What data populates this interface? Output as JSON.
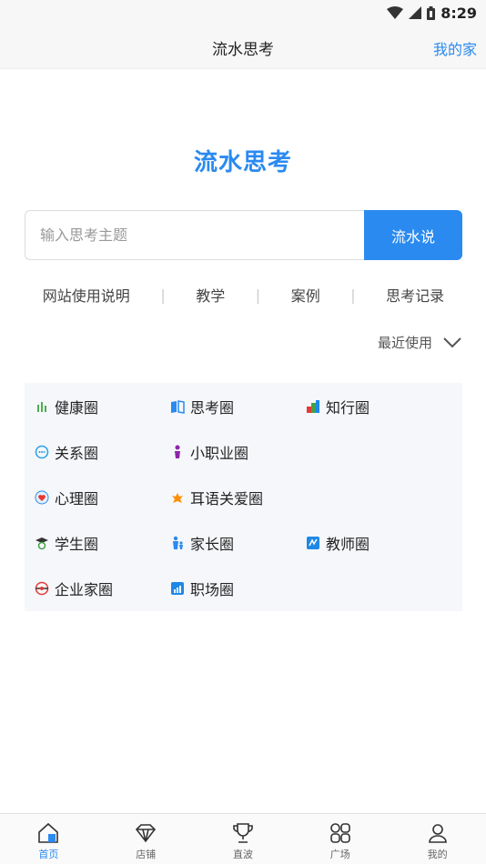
{
  "status": {
    "time": "8:29"
  },
  "header": {
    "title": "流水思考",
    "right_link": "我的家"
  },
  "brand": {
    "title": "流水思考"
  },
  "search": {
    "placeholder": "输入思考主题",
    "value": "",
    "button": "流水说"
  },
  "links": [
    "网站使用说明",
    "教学",
    "案例",
    "思考记录"
  ],
  "recent": {
    "label": "最近使用"
  },
  "circles": [
    {
      "label": "健康圈",
      "icon": "leaf-icon",
      "color": "#4caf50"
    },
    {
      "label": "思考圈",
      "icon": "book-icon",
      "color": "#2a8af0"
    },
    {
      "label": "知行圈",
      "icon": "blocks-icon",
      "color": "#e53935"
    },
    {
      "label": "关系圈",
      "icon": "chat-bubble-icon",
      "color": "#29a0e8"
    },
    {
      "label": "小职业圈",
      "icon": "person-icon",
      "color": "#8e24aa"
    },
    {
      "label": "心理圈",
      "icon": "heart-shield-icon",
      "color": "#e53935"
    },
    {
      "label": "耳语关爱圈",
      "icon": "sparkle-icon",
      "color": "#ff8f00"
    },
    {
      "label": "学生圈",
      "icon": "graduate-icon",
      "color": "#43a047"
    },
    {
      "label": "家长圈",
      "icon": "family-icon",
      "color": "#2a8af0"
    },
    {
      "label": "教师圈",
      "icon": "teacher-icon",
      "color": "#1e88e5"
    },
    {
      "label": "企业家圈",
      "icon": "badge-icon",
      "color": "#e53935"
    },
    {
      "label": "职场圈",
      "icon": "chart-icon",
      "color": "#1e88e5"
    }
  ],
  "tabs": [
    {
      "label": "首页",
      "icon": "home-icon"
    },
    {
      "label": "店铺",
      "icon": "diamond-icon"
    },
    {
      "label": "直波",
      "icon": "trophy-icon"
    },
    {
      "label": "广场",
      "icon": "grid-icon"
    },
    {
      "label": "我的",
      "icon": "user-icon"
    }
  ],
  "colors": {
    "accent": "#2a8af0",
    "panel": "#f5f7fa"
  }
}
